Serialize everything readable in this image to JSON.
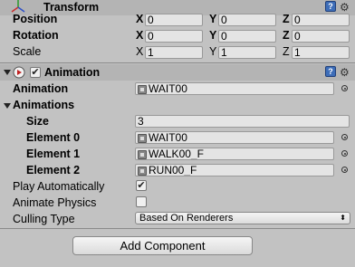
{
  "transform": {
    "title": "Transform",
    "rows": [
      {
        "label": "Position",
        "x": "0",
        "y": "0",
        "z": "0"
      },
      {
        "label": "Rotation",
        "x": "0",
        "y": "0",
        "z": "0"
      },
      {
        "label": "Scale",
        "x": "1",
        "y": "1",
        "z": "1"
      }
    ],
    "axis": {
      "x": "X",
      "y": "Y",
      "z": "Z"
    }
  },
  "animation": {
    "title": "Animation",
    "enabled": true,
    "clip_label": "Animation",
    "clip_value": "WAIT00",
    "animations_label": "Animations",
    "size_label": "Size",
    "size_value": "3",
    "elements": [
      {
        "label": "Element 0",
        "value": "WAIT00"
      },
      {
        "label": "Element 1",
        "value": "WALK00_F"
      },
      {
        "label": "Element 2",
        "value": "RUN00_F"
      }
    ],
    "play_auto_label": "Play Automatically",
    "play_auto_checked": true,
    "check_mark": "✔",
    "animate_physics_label": "Animate Physics",
    "animate_physics_checked": false,
    "culling_label": "Culling Type",
    "culling_value": "Based On Renderers"
  },
  "icons": {
    "help": "?",
    "gear": "⚙",
    "dropdown": "⬍"
  },
  "add_component_label": "Add Component"
}
